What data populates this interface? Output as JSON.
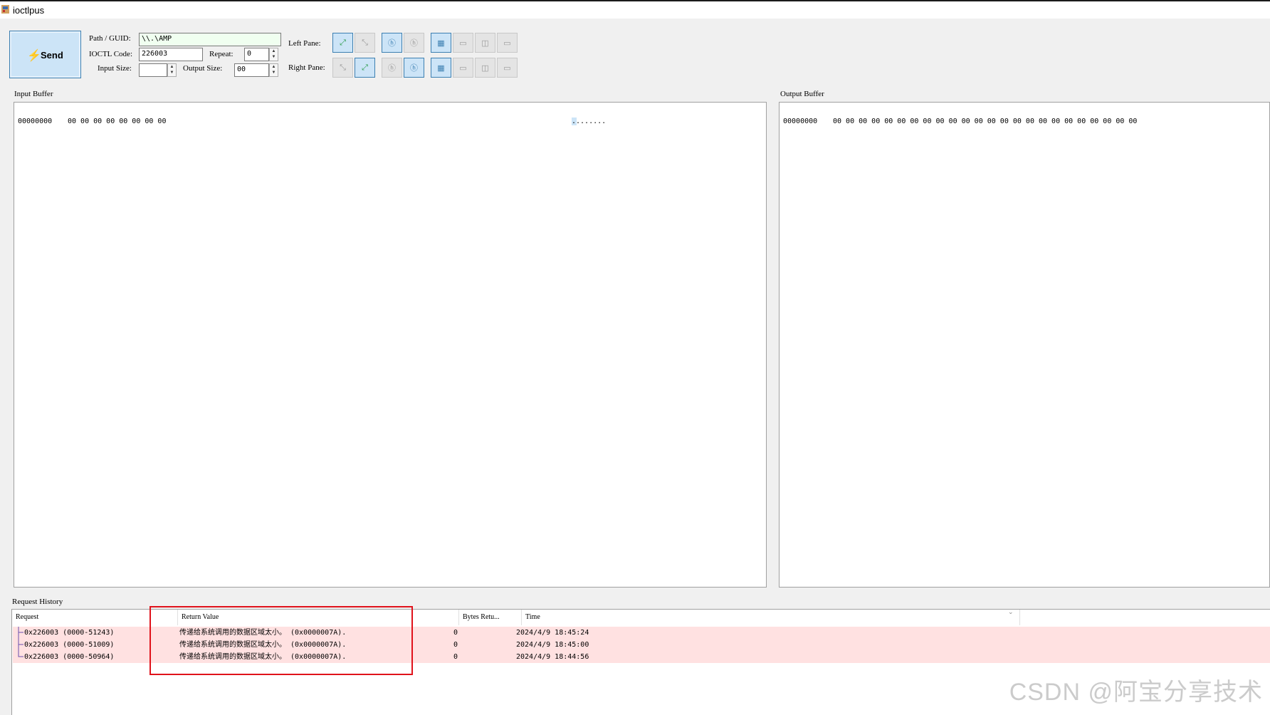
{
  "window": {
    "title": "ioctlpus"
  },
  "toolbar": {
    "send_label": "Send",
    "path_label": "Path / GUID:",
    "path_value": "\\\\.\\AMP",
    "ioctl_label": "IOCTL Code:",
    "ioctl_value": "226003",
    "repeat_label": "Repeat:",
    "repeat_value": "0",
    "input_size_label": "Input Size:",
    "input_size_value": "",
    "output_size_label": "Output Size:",
    "output_size_value": "00",
    "left_pane_label": "Left Pane:",
    "right_pane_label": "Right Pane:"
  },
  "input_buffer": {
    "label": "Input Buffer",
    "offset": "00000000",
    "hex": "00 00 00 00 00 00 00 00",
    "ascii": "........"
  },
  "output_buffer": {
    "label": "Output Buffer",
    "offset": "00000000",
    "hex": "00 00 00 00 00 00 00 00 00 00 00 00 00 00 00 00 00 00 00 00 00 00 00 00"
  },
  "history": {
    "label": "Request History",
    "columns": [
      "Request",
      "Return Value",
      "Bytes Retu...",
      "Time"
    ],
    "rows": [
      {
        "request": "0x226003 (0000-51243)",
        "return_value": "传递给系统调用的数据区域太小。 (0x0000007A).",
        "bytes": "0",
        "time": "2024/4/9 18:45:24"
      },
      {
        "request": "0x226003 (0000-51009)",
        "return_value": "传递给系统调用的数据区域太小。 (0x0000007A).",
        "bytes": "0",
        "time": "2024/4/9 18:45:00"
      },
      {
        "request": "0x226003 (0000-50964)",
        "return_value": "传递给系统调用的数据区域太小。 (0x0000007A).",
        "bytes": "0",
        "time": "2024/4/9 18:44:56"
      }
    ]
  },
  "watermark": "CSDN @阿宝分享技术",
  "colors": {
    "highlight_row": "#ffe1e1",
    "annotation_box": "#e0121b",
    "button_active": "#cce4f7"
  }
}
